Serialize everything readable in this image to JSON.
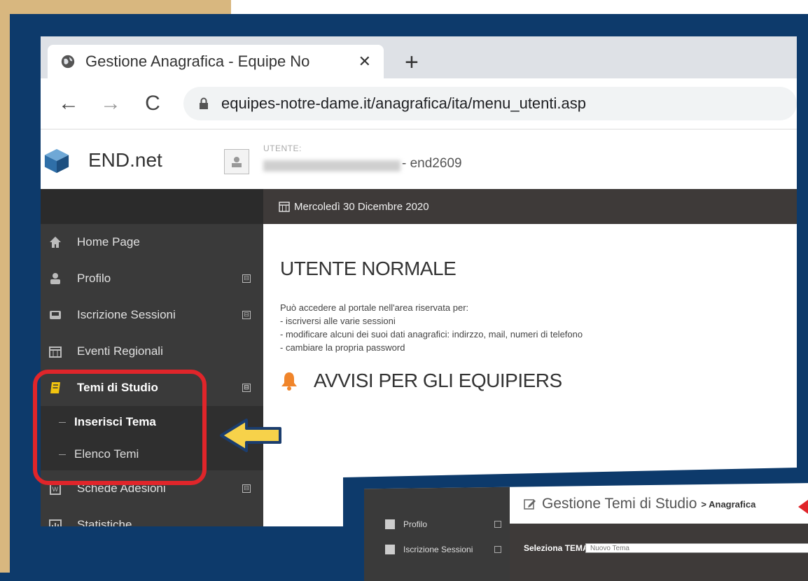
{
  "browser": {
    "tab_title": "Gestione Anagrafica - Equipe No",
    "close_glyph": "✕",
    "new_tab_glyph": "+",
    "back_glyph": "←",
    "forward_glyph": "→",
    "reload_glyph": "C",
    "url": "equipes-notre-dame.it/anagrafica/ita/menu_utenti.asp"
  },
  "app": {
    "brand": "END.net",
    "user_label": "UTENTE:",
    "user_id": "- end2609",
    "date": "Mercoledì 30 Dicembre 2020"
  },
  "sidebar": {
    "items": [
      {
        "label": "Home Page",
        "icon": "home-icon"
      },
      {
        "label": "Profilo",
        "icon": "user-icon",
        "expand": "⊟"
      },
      {
        "label": "Iscrizione Sessioni",
        "icon": "inbox-icon",
        "expand": "⊟"
      },
      {
        "label": "Eventi Regionali",
        "icon": "calendar-icon"
      },
      {
        "label": "Temi di Studio",
        "icon": "book-icon",
        "expand": "⊟"
      },
      {
        "label": "Schede Adesioni",
        "icon": "word-doc-icon",
        "expand": "⊟"
      },
      {
        "label": "Statistiche",
        "icon": "bar-chart-icon"
      }
    ],
    "subitems": [
      {
        "label": "Inserisci Tema"
      },
      {
        "label": "Elenco Temi"
      }
    ]
  },
  "main": {
    "heading": "UTENTE NORMALE",
    "intro_lines": [
      "Può accedere al portale nell'area riservata per:",
      "- iscriversi alle varie sessioni",
      "- modificare alcuni dei suoi dati anagrafici: indirzzo, mail, numeri di telefono",
      "- cambiare la propria password"
    ],
    "notice_title": "AVVISI PER GLI EQUIPIERS"
  },
  "second_screenshot": {
    "title": "Gestione Temi di Studio",
    "breadcrumb": "> Anagrafica",
    "sidebar_items": [
      "Profilo",
      "Iscrizione Sessioni"
    ],
    "select_label": "Seleziona TEMA",
    "select_value": "Nuovo Tema"
  },
  "colors": {
    "background": "#0d3a6b",
    "highlight": "#e0252a",
    "arrow_fill": "#f7d24a",
    "sidebar": "#3a3a3a"
  }
}
